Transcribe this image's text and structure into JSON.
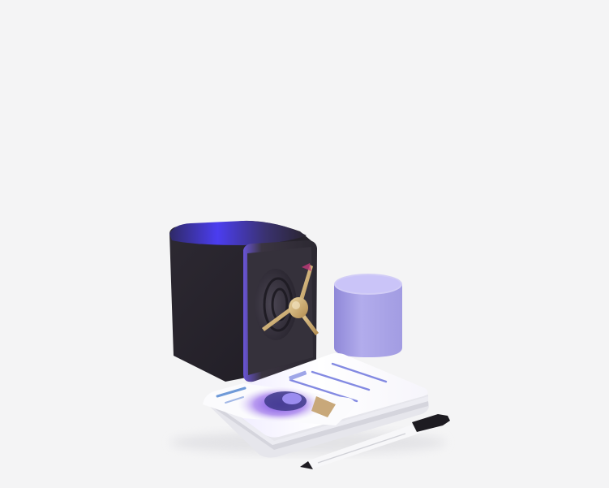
{
  "scene": {
    "background_color": "#f4f4f5",
    "subject": "safe-with-documents-illustration",
    "colors": {
      "safe_body": "#2b2733",
      "safe_highlight": "#4b3df0",
      "safe_door": "#38343e",
      "handle_gold": "#c9a86a",
      "cylinder_lavender": "#a9a2e6",
      "paper_white": "#ffffff",
      "paper_line_blue": "#5b64d9",
      "pen_black": "#1d1b21"
    }
  }
}
